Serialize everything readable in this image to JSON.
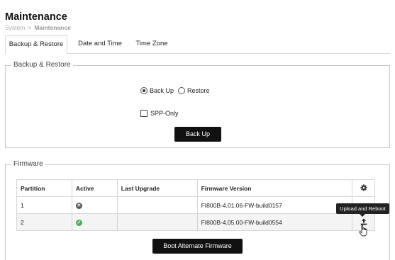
{
  "page": {
    "title": "Maintenance"
  },
  "breadcrumb": {
    "root": "System",
    "separator": ">",
    "current": "Maintenance"
  },
  "tabs": [
    {
      "label": "Backup & Restore",
      "active": true
    },
    {
      "label": "Date and Time",
      "active": false
    },
    {
      "label": "Time Zone",
      "active": false
    }
  ],
  "backup": {
    "legend": "Backup & Restore",
    "options": [
      {
        "label": "Back Up",
        "selected": true
      },
      {
        "label": "Restore",
        "selected": false
      }
    ],
    "spp_only_label": "SPP-Only",
    "spp_only_checked": false,
    "button_label": "Back Up"
  },
  "firmware": {
    "legend": "Firmware",
    "columns": [
      "Partition",
      "Active",
      "Last Upgrade",
      "Firmware Version"
    ],
    "settings_icon": "gear-icon",
    "rows": [
      {
        "partition": "1",
        "active_icon": "inactive-x-icon",
        "last_upgrade": "",
        "version": "FI800B-4.01.06-FW-build0157"
      },
      {
        "partition": "2",
        "active_icon": "active-check-icon",
        "last_upgrade": "",
        "version": "FI800B-4.05.00-FW-build0554"
      }
    ],
    "upload_tooltip": "Upload and Reboot",
    "boot_button_label": "Boot Alternate Firmware"
  },
  "colors": {
    "button_bg": "#111111",
    "active_green": "#4caf50",
    "inactive_gray": "#555555"
  }
}
